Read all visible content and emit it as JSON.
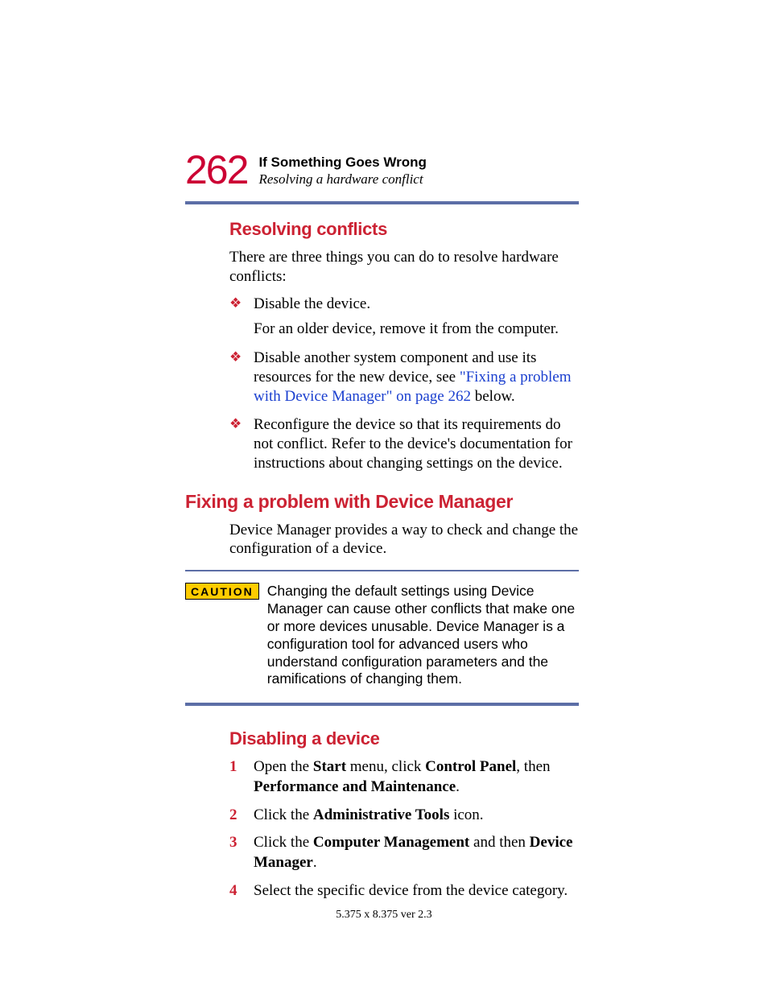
{
  "page_number": "262",
  "header": {
    "chapter": "If Something Goes Wrong",
    "section": "Resolving a hardware conflict"
  },
  "s1": {
    "heading": "Resolving conflicts",
    "intro": "There are three things you can do to resolve hardware conflicts:",
    "b1_main": "Disable the device.",
    "b1_sub": "For an older device, remove it from the computer.",
    "b2_pre": "Disable another system component and use its resources for the new device, see ",
    "b2_link": "\"Fixing a problem with Device Manager\" on page 262",
    "b2_post": " below.",
    "b3": "Reconfigure the device so that its requirements do not conflict. Refer to the device's documentation for instructions about changing settings on the device."
  },
  "s2": {
    "heading": "Fixing a problem with Device Manager",
    "intro": "Device Manager provides a way to check and change the configuration of a device."
  },
  "caution": {
    "label": "CAUTION",
    "text": "Changing the default settings using Device Manager can cause other conflicts that make one or more devices unusable. Device Manager is a configuration tool for advanced users who understand configuration parameters and the ramifications of changing them."
  },
  "s3": {
    "heading": "Disabling a device",
    "step1_a": "Open the ",
    "step1_b": "Start",
    "step1_c": " menu, click ",
    "step1_d": "Control Panel",
    "step1_e": ", then ",
    "step1_f": "Performance and Maintenance",
    "step1_g": ".",
    "step2_a": "Click the ",
    "step2_b": "Administrative Tools",
    "step2_c": " icon.",
    "step3_a": "Click the ",
    "step3_b": "Computer Management",
    "step3_c": " and then ",
    "step3_d": "Device Manager",
    "step3_e": ".",
    "step4": "Select the specific device from the device category."
  },
  "footer": "5.375 x 8.375 ver 2.3"
}
